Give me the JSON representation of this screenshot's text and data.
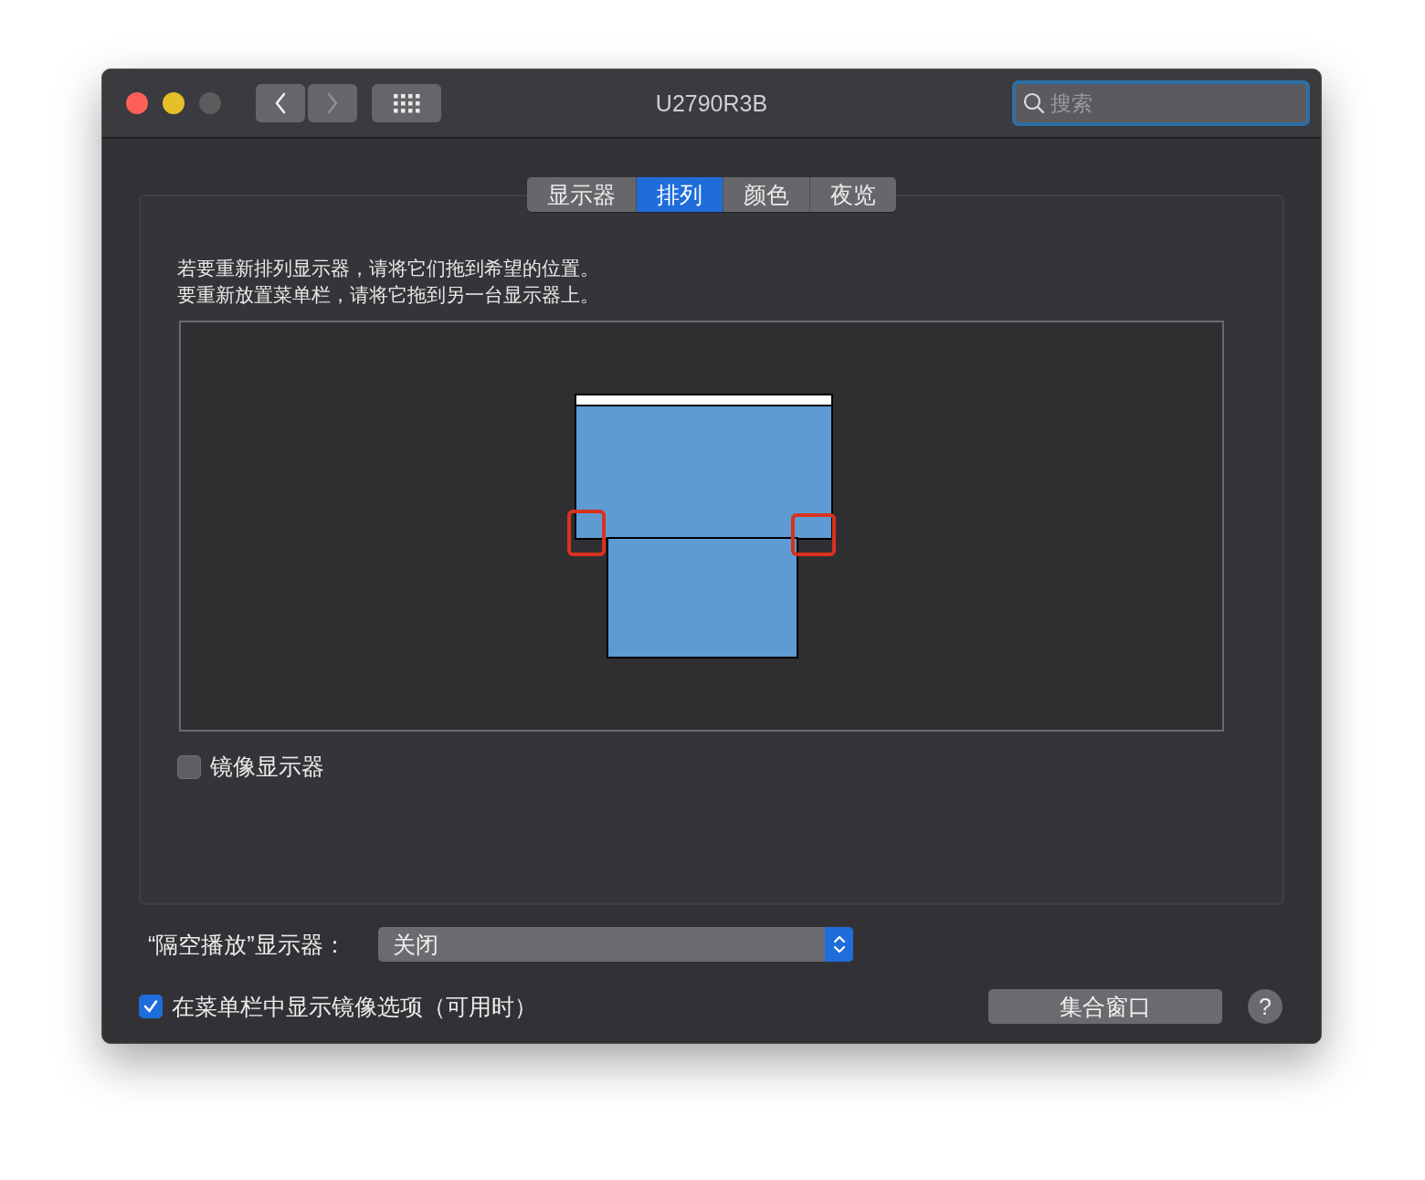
{
  "window": {
    "title": "U2790R3B"
  },
  "nav": {
    "back": {
      "disabled": false
    },
    "forward": {
      "disabled": true
    }
  },
  "search": {
    "placeholder": "搜索"
  },
  "tabs": [
    {
      "label": "显示器",
      "selected": false
    },
    {
      "label": "排列",
      "selected": true
    },
    {
      "label": "颜色",
      "selected": false
    },
    {
      "label": "夜览",
      "selected": false
    }
  ],
  "instructions": [
    "若要重新排列显示器，请将它们拖到希望的位置。",
    "要重新放置菜单栏，请将它拖到另一台显示器上。"
  ],
  "displays": [
    {
      "kind": "main"
    },
    {
      "kind": "secondary"
    }
  ],
  "mirror": {
    "label": "镜像显示器",
    "checked": false
  },
  "airplay": {
    "label": "“隔空播放”显示器：",
    "value": "关闭"
  },
  "menu_option": {
    "label": "在菜单栏中显示镜像选项（可用时）",
    "checked": true
  },
  "gather_button": "集合窗口",
  "help": "?"
}
